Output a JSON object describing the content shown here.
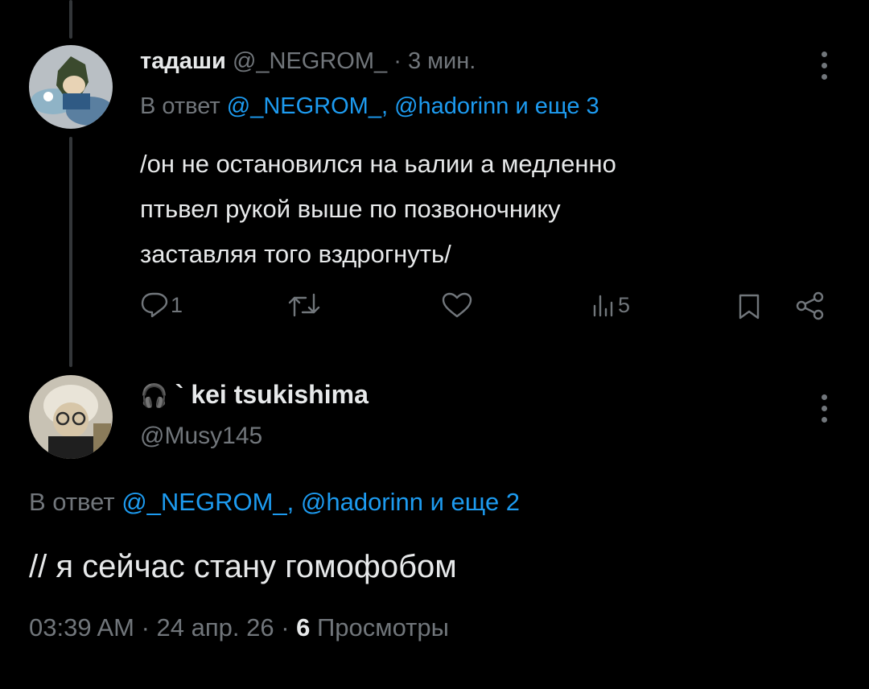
{
  "reply_tweet": {
    "display_name": "тадаши",
    "handle": "@_NEGROM_",
    "separator": "·",
    "time": "3 мин.",
    "reply_prefix": "В ответ",
    "reply_users": "@_NEGROM_, @hadorinn и еще 3",
    "text_lines": [
      "/он не остановился на ьалии а медленно",
      "птьвел рукой выше по позвоночнику",
      "заставляя того вздрогнуть/"
    ],
    "stats": {
      "replies": "1",
      "reposts": "",
      "likes": "",
      "views": "5"
    },
    "icons": [
      "reply-icon",
      "repost-icon",
      "like-icon",
      "views-icon",
      "bookmark-icon",
      "share-icon",
      "more-icon"
    ]
  },
  "main_tweet": {
    "name_emoji": "🎧",
    "display_name": "` kei tsukishima",
    "handle": "@Musy145",
    "reply_prefix": "В ответ",
    "reply_users": "@_NEGROM_, @hadorinn и еще 2",
    "text": "// я сейчас стану гомофобом",
    "timestamp": "03:39 AM · 24 апр. 26 · ",
    "views_count": "6",
    "views_label": " Просмотры"
  },
  "colors": {
    "background": "#000000",
    "text": "#e7e9ea",
    "muted": "#71767b",
    "link": "#1d9bf0"
  }
}
